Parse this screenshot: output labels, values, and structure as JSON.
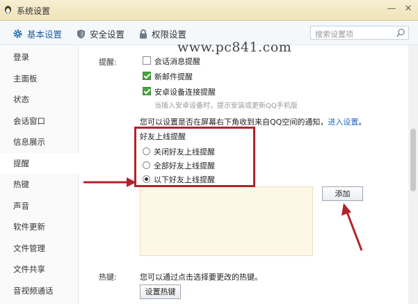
{
  "window": {
    "title": "系统设置",
    "minimize_glyph": "—",
    "close_glyph": "✕"
  },
  "tabs": [
    {
      "label": "基本设置",
      "icon": "gear-icon"
    },
    {
      "label": "安全设置",
      "icon": "shield-icon"
    },
    {
      "label": "权限设置",
      "icon": "lock-icon"
    }
  ],
  "search": {
    "placeholder": "搜索设置项",
    "icon": "search-icon"
  },
  "sidebar": {
    "items": [
      {
        "label": "登录"
      },
      {
        "label": "主面板"
      },
      {
        "label": "状态"
      },
      {
        "label": "会话窗口"
      },
      {
        "label": "信息展示"
      },
      {
        "label": "提醒"
      },
      {
        "label": "热键"
      },
      {
        "label": "声音"
      },
      {
        "label": "软件更新"
      },
      {
        "label": "文件管理"
      },
      {
        "label": "文件共享"
      },
      {
        "label": "音视频通话"
      }
    ],
    "active": "提醒"
  },
  "reminder": {
    "section_label": "提醒:",
    "options": [
      {
        "label": "会话消息提醒",
        "checked": false
      },
      {
        "label": "新邮件提醒",
        "checked": true
      },
      {
        "label": "安卓设备连接提醒",
        "checked": true
      }
    ],
    "android_hint": "当插入安卓设备时，提示安装或更新QQ手机版",
    "qzone_text": "您可以设置是否在屏幕右下角收到来自QQ空间的通知，",
    "qzone_link": "进入设置",
    "qzone_end": "。"
  },
  "friend_online": {
    "title": "好友上线提醒",
    "options": [
      {
        "label": "关闭好友上线提醒",
        "selected": false
      },
      {
        "label": "全部好友上线提醒",
        "selected": false
      },
      {
        "label": "以下好友上线提醒",
        "selected": true
      }
    ],
    "add_button": "添加"
  },
  "hotkey": {
    "section_label": "热键:",
    "description": "您可以通过点击选择要更改的热键。",
    "button": "设置热键"
  },
  "watermark": "www.pc841.com",
  "colors": {
    "highlight": "#b1232b",
    "checkbox_on": "#4aa33e",
    "link": "#1a6bbf"
  }
}
